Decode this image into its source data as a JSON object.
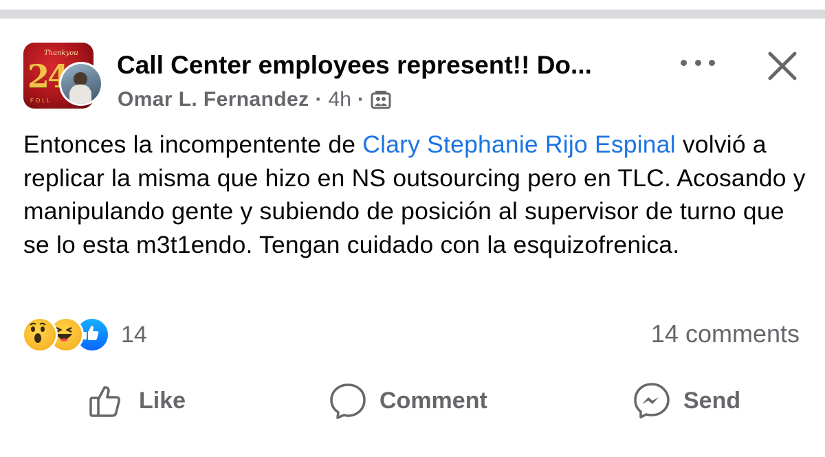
{
  "post": {
    "title": "Call Center employees represent!! Do...",
    "author": "Omar L. Fernandez",
    "time": "4h",
    "separator": "·",
    "body_prefix": "Entonces la incompentente de ",
    "mention": "Clary Stephanie Rijo Espinal",
    "body_rest": " volvió a replicar la misma que hizo en NS outsourcing pero en TLC. Acosando y manipulando gente y subiendo de posición al supervisor de turno que se lo esta m3t1endo. Tengan cuidado con la esquizofrenica.",
    "group_avatar_text": "24",
    "group_avatar_script": "Thankyou",
    "group_avatar_tag": "FOLL"
  },
  "reactions": {
    "icons": [
      "wow-reaction-icon",
      "haha-reaction-icon",
      "like-reaction-icon"
    ],
    "count": "14",
    "comments": "14 comments"
  },
  "actions": {
    "like": "Like",
    "comment": "Comment",
    "send": "Send"
  },
  "colors": {
    "mention": "#1b74e4",
    "secondary_text": "#65676b",
    "like_blue": "#0866ff",
    "reaction_yellow": "#f7b125"
  }
}
